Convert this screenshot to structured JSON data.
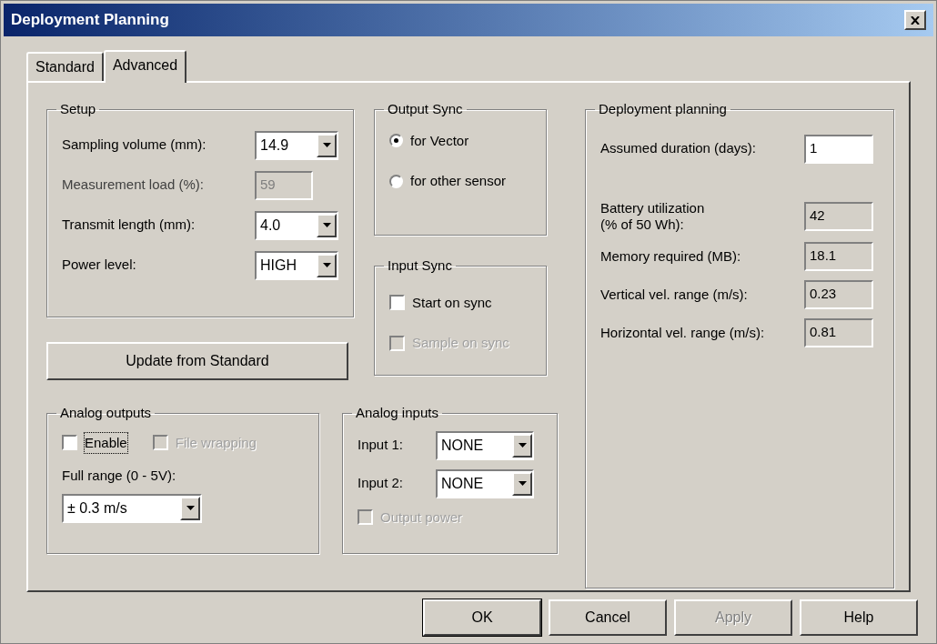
{
  "window": {
    "title": "Deployment Planning"
  },
  "tabs": [
    {
      "label": "Standard",
      "selected": false
    },
    {
      "label": "Advanced",
      "selected": true
    }
  ],
  "setup": {
    "title": "Setup",
    "fields": [
      {
        "label": "Sampling volume (mm):",
        "value": "14.9",
        "kind": "dropdown",
        "disabled": false
      },
      {
        "label": "Measurement load (%):",
        "value": "59",
        "kind": "readonly",
        "disabled": true
      },
      {
        "label": "Transmit length (mm):",
        "value": "4.0",
        "kind": "dropdown",
        "disabled": false
      },
      {
        "label": "Power level:",
        "value": "HIGH",
        "kind": "dropdown",
        "disabled": false
      }
    ]
  },
  "output_sync": {
    "title": "Output Sync",
    "options": [
      {
        "label": "for Vector",
        "selected": true
      },
      {
        "label": "for other sensor",
        "selected": false
      }
    ]
  },
  "input_sync": {
    "title": "Input Sync",
    "checkboxes": [
      {
        "label": "Start on sync",
        "checked": false,
        "disabled": false
      },
      {
        "label": "Sample on sync",
        "checked": false,
        "disabled": true
      }
    ]
  },
  "update_button": {
    "label": "Update from Standard"
  },
  "analog_outputs": {
    "title": "Analog outputs",
    "checkboxes": [
      {
        "label": "Enable",
        "checked": false,
        "disabled": false,
        "focused": true
      },
      {
        "label": "File wrapping",
        "checked": false,
        "disabled": true,
        "focused": false
      }
    ],
    "range_label": "Full range (0 - 5V):",
    "range_value": "± 0.3 m/s"
  },
  "analog_inputs": {
    "title": "Analog inputs",
    "inputs": [
      {
        "label": "Input 1:",
        "value": "NONE"
      },
      {
        "label": "Input 2:",
        "value": "NONE"
      }
    ],
    "checkboxes": [
      {
        "label": "Output power",
        "checked": false,
        "disabled": true
      }
    ]
  },
  "deployment": {
    "title": "Deployment planning",
    "duration": {
      "label": "Assumed duration (days):",
      "value": "1"
    },
    "readings": [
      {
        "label": "Battery utilization\n(% of 50 Wh):",
        "value": "42"
      },
      {
        "label": "Memory required (MB):",
        "value": "18.1"
      },
      {
        "label": "Vertical vel. range (m/s):",
        "value": "0.23"
      },
      {
        "label": "Horizontal vel. range (m/s):",
        "value": "0.81"
      }
    ]
  },
  "buttons": [
    {
      "label": "OK",
      "disabled": false,
      "default": true
    },
    {
      "label": "Cancel",
      "disabled": false,
      "default": false
    },
    {
      "label": "Apply",
      "disabled": true,
      "default": false
    },
    {
      "label": "Help",
      "disabled": false,
      "default": false
    }
  ]
}
